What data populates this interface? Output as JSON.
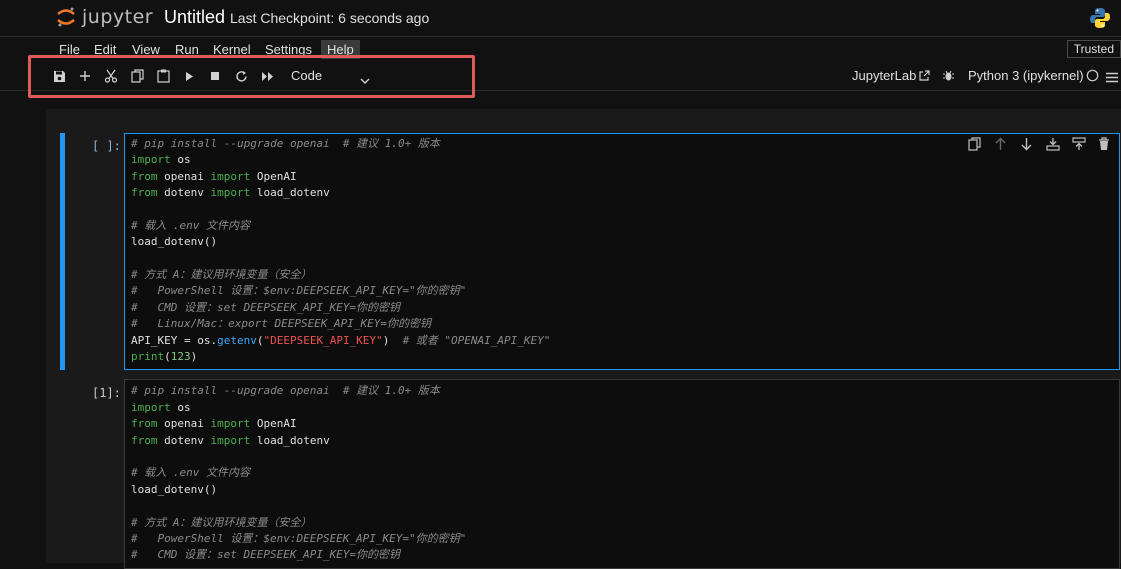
{
  "header": {
    "app_name": "jupyter",
    "notebook_title": "Untitled",
    "checkpoint": "Last Checkpoint: 6 seconds ago"
  },
  "menu": {
    "items": [
      "File",
      "Edit",
      "View",
      "Run",
      "Kernel",
      "Settings",
      "Help"
    ],
    "trusted": "Trusted"
  },
  "toolbar": {
    "cell_type": "Code",
    "jupyterlab": "JupyterLab",
    "kernel": "Python 3 (ipykernel)"
  },
  "cells": [
    {
      "prompt": "[ ]:",
      "lines": [
        "# pip install --upgrade openai  # 建议 1.0+ 版本",
        "import os",
        "from openai import OpenAI",
        "from dotenv import load_dotenv",
        "",
        "# 载入 .env 文件内容",
        "load_dotenv()",
        "",
        "# 方式 A：建议用环境变量（安全）",
        "#   PowerShell 设置：$env:DEEPSEEK_API_KEY=\"你的密钥\"",
        "#   CMD 设置：set DEEPSEEK_API_KEY=你的密钥",
        "#   Linux/Mac：export DEEPSEEK_API_KEY=你的密钥",
        "API_KEY = os.getenv(\"DEEPSEEK_API_KEY\")  # 或者 \"OPENAI_API_KEY\"",
        "print(123)"
      ]
    },
    {
      "prompt": "[1]:",
      "lines": [
        "# pip install --upgrade openai  # 建议 1.0+ 版本",
        "import os",
        "from openai import OpenAI",
        "from dotenv import load_dotenv",
        "",
        "# 载入 .env 文件内容",
        "load_dotenv()",
        "",
        "# 方式 A：建议用环境变量（安全）",
        "#   PowerShell 设置：$env:DEEPSEEK_API_KEY=\"你的密钥\"",
        "#   CMD 设置：set DEEPSEEK_API_KEY=你的密钥"
      ]
    }
  ],
  "colors": {
    "accent": "#2196f3",
    "highlight": "#e05a5a",
    "keyword": "#4caf50",
    "string": "#ef5350",
    "comment": "#8a8a8a"
  }
}
